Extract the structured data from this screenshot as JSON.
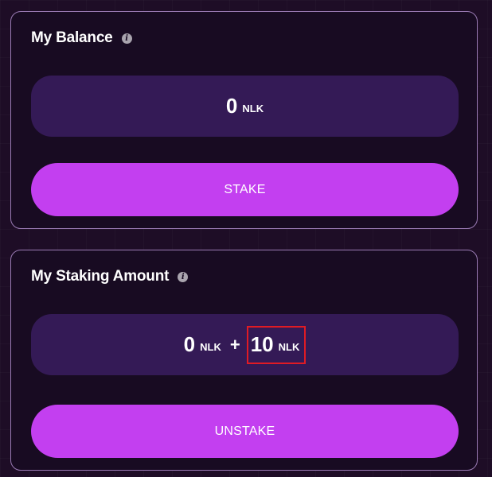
{
  "balance": {
    "title": "My Balance",
    "amount": "0",
    "unit": "NLK",
    "button_label": "STAKE"
  },
  "staking": {
    "title": "My Staking Amount",
    "amount": "0",
    "unit": "NLK",
    "plus": "+",
    "reward_amount": "10",
    "reward_unit": "NLK",
    "button_label": "UNSTAKE"
  },
  "icons": {
    "info": "info-icon",
    "info_glyph": "i"
  },
  "colors": {
    "background": "#1e0d26",
    "card": "#180b22",
    "value_box": "#341a56",
    "button": "#c33ff0",
    "highlight": "#e01b24"
  }
}
